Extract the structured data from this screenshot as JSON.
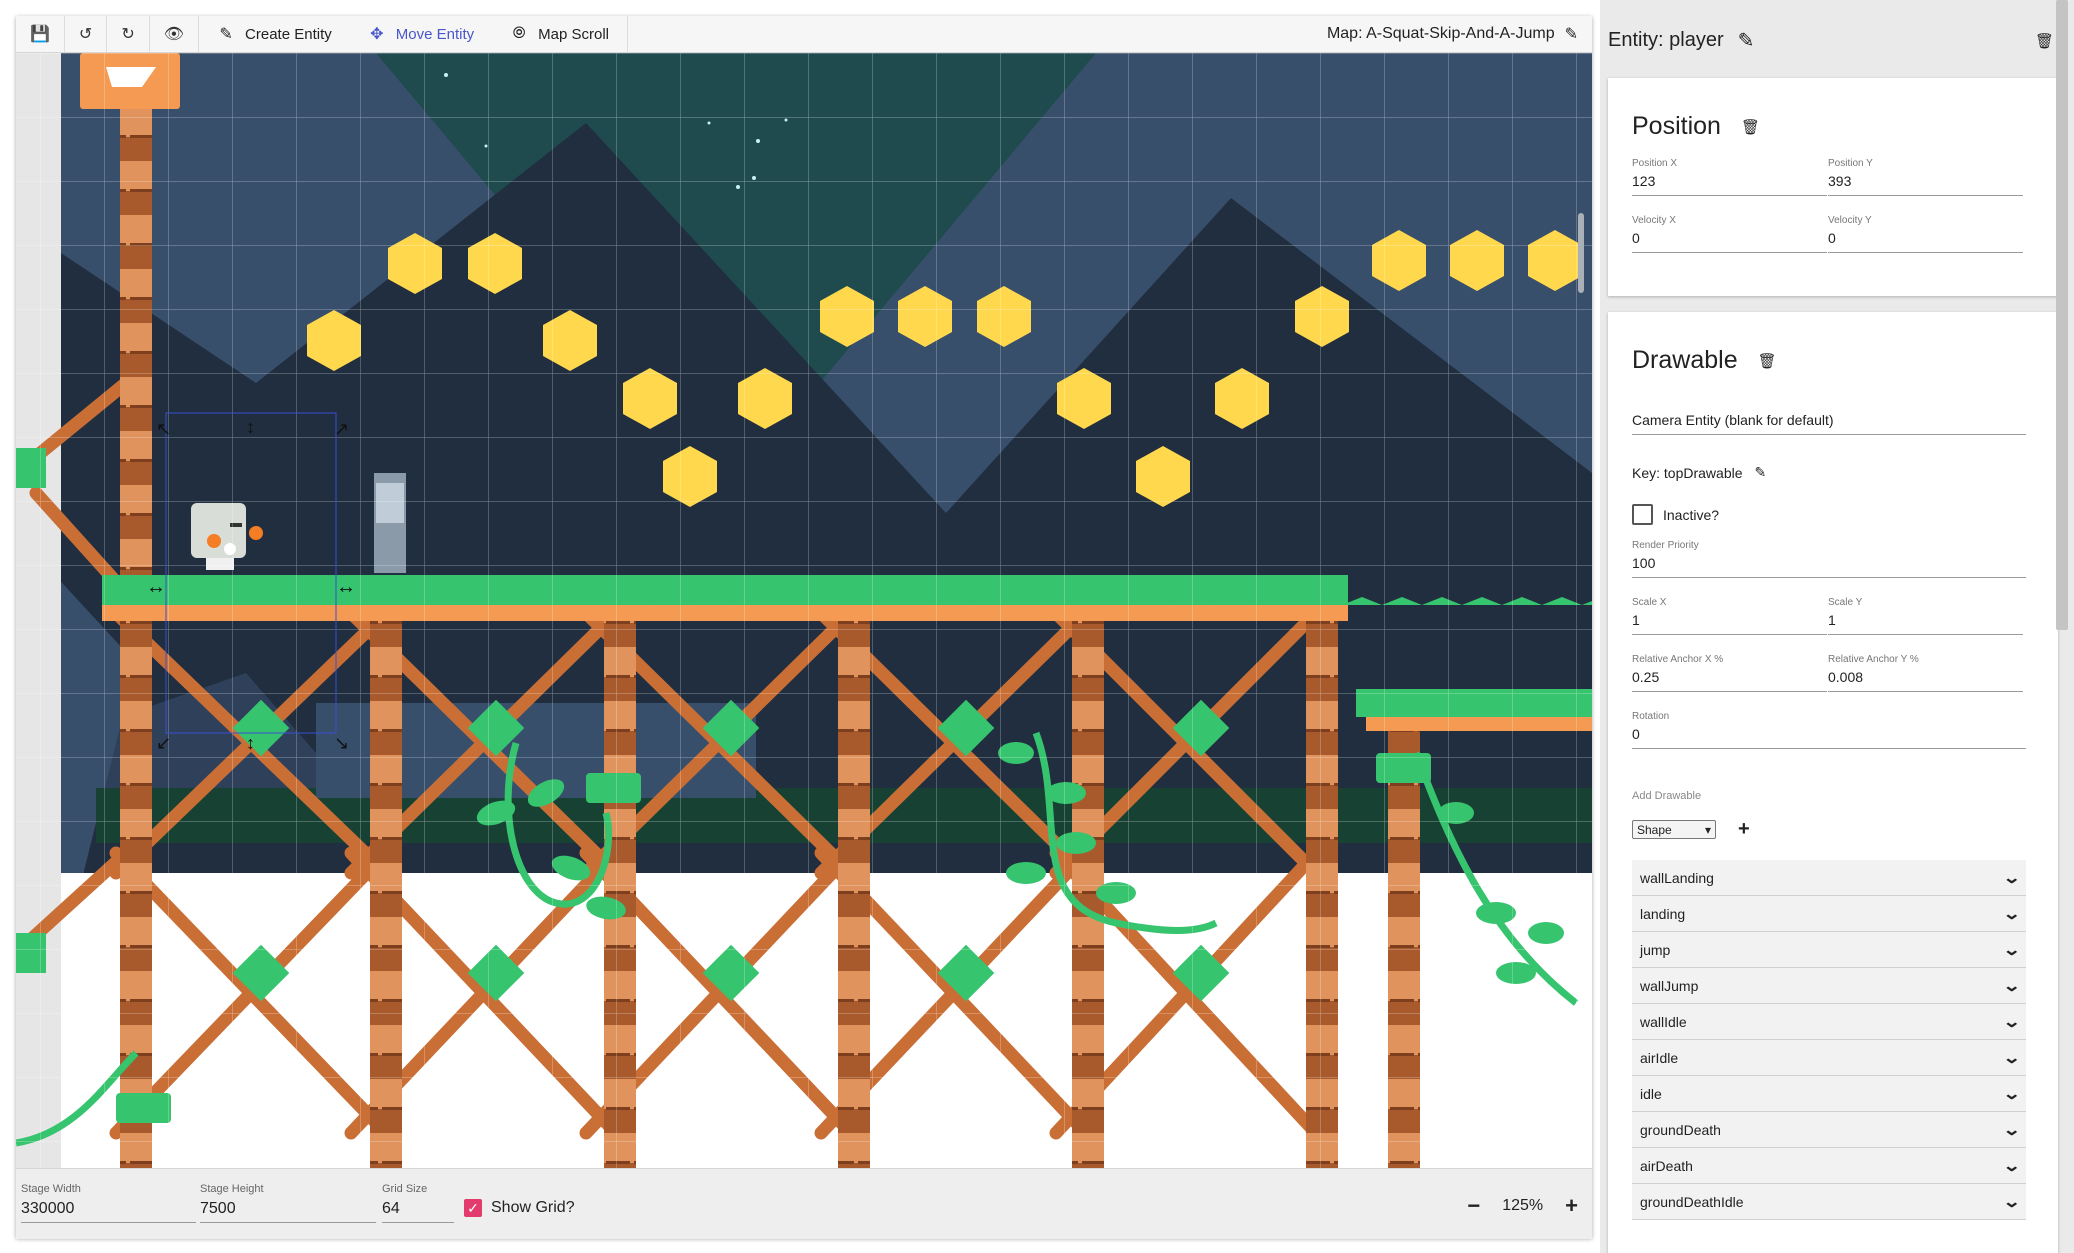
{
  "toolbar": {
    "save_icon": "save-icon",
    "undo_icon": "undo-icon",
    "redo_icon": "redo-icon",
    "preview_icon": "eye-icon",
    "tools": [
      {
        "label": "Create Entity",
        "icon": "pencil-icon",
        "active": false
      },
      {
        "label": "Move Entity",
        "icon": "move-icon",
        "active": true
      },
      {
        "label": "Map Scroll",
        "icon": "compass-icon",
        "active": false
      }
    ],
    "map_title": "Map: A-Squat-Skip-And-A-Jump"
  },
  "stage": {
    "width_label": "Stage Width",
    "width_value": "330000",
    "height_label": "Stage Height",
    "height_value": "7500",
    "grid_label": "Grid Size",
    "grid_value": "64",
    "show_grid_label": "Show Grid?",
    "show_grid": true,
    "zoom_minus": "−",
    "zoom_value": "125%",
    "zoom_plus": "+"
  },
  "entity": {
    "title": "Entity: player",
    "position": {
      "title": "Position",
      "pos_x_label": "Position X",
      "pos_x": "123",
      "pos_y_label": "Position Y",
      "pos_y": "393",
      "vel_x_label": "Velocity X",
      "vel_x": "0",
      "vel_y_label": "Velocity Y",
      "vel_y": "0"
    },
    "drawable": {
      "title": "Drawable",
      "camera_placeholder": "Camera Entity (blank for default)",
      "key_label": "Key: topDrawable",
      "inactive_label": "Inactive?",
      "render_priority_label": "Render Priority",
      "render_priority": "100",
      "scale_x_label": "Scale X",
      "scale_x": "1",
      "scale_y_label": "Scale Y",
      "scale_y": "1",
      "anchor_x_label": "Relative Anchor X %",
      "anchor_x": "0.25",
      "anchor_y_label": "Relative Anchor Y %",
      "anchor_y": "0.008",
      "rotation_label": "Rotation",
      "rotation": "0",
      "add_label": "Add Drawable",
      "add_select": "Shape",
      "add_plus": "+",
      "animations": [
        "wallLanding",
        "landing",
        "jump",
        "wallJump",
        "wallIdle",
        "airIdle",
        "idle",
        "groundDeath",
        "airDeath",
        "groundDeathIdle"
      ]
    }
  },
  "colors": {
    "sky": "#384f6b",
    "mountain_dark": "#202e3f",
    "teal": "#1f4b4e",
    "coin": "#ffd84d",
    "grass": "#37c46e",
    "orange": "#f59a52",
    "wood": "#b2602f",
    "accent": "#4a57c8",
    "check": "#e23b6c"
  }
}
